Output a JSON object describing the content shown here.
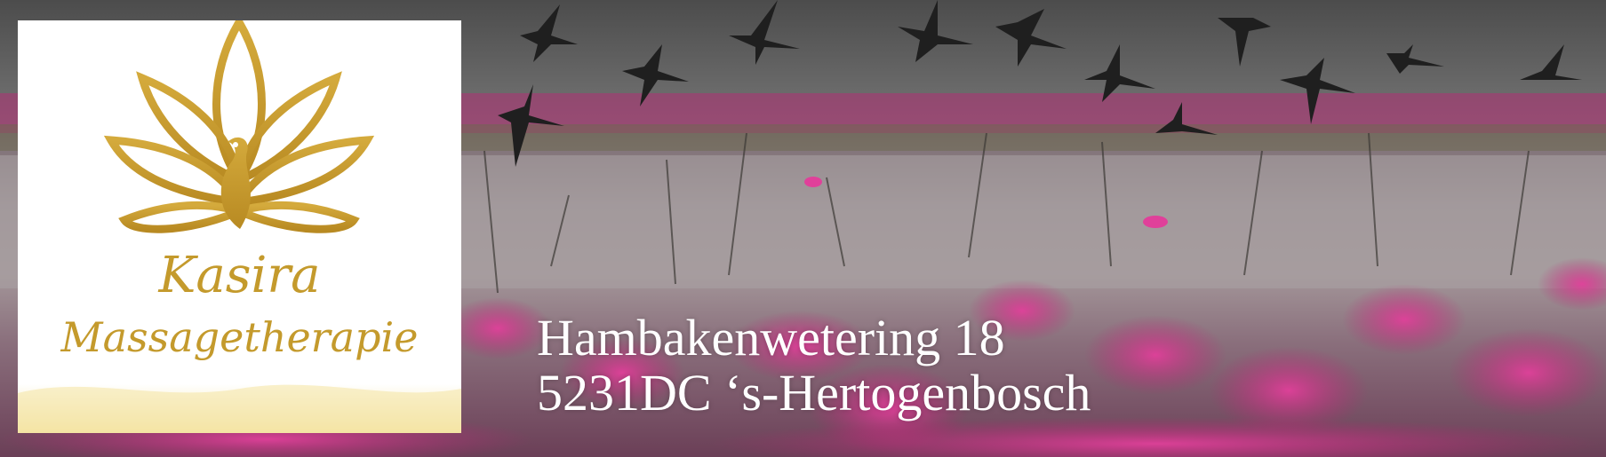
{
  "logo": {
    "line1": "Kasira",
    "line2": "Massagetherapie",
    "icon": "lotus-peacock-icon",
    "color": "#c49a2c"
  },
  "address": {
    "street": "Hambakenwetering 18",
    "city": "5231DC ‘s-Hertogenbosch"
  },
  "background": {
    "description_icon": "birds-over-lotus-lake",
    "colors": {
      "sky": "#6e6e6e",
      "water": "#8f8a8c",
      "flowers": "#c4307a"
    }
  }
}
